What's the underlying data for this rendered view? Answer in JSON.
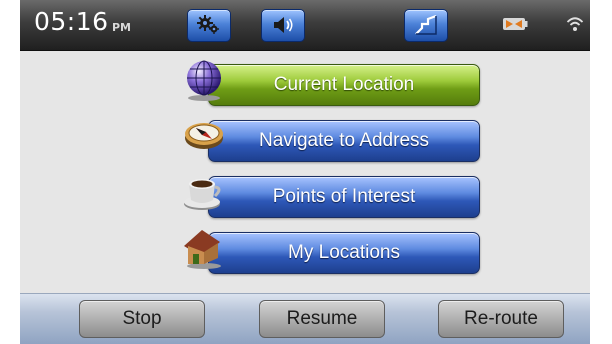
{
  "status_bar": {
    "time": "05:16",
    "ampm": "PM",
    "icons": [
      "gear-icon",
      "speaker-icon",
      "map-icon",
      "battery-icon",
      "wifi-icon"
    ]
  },
  "menu": {
    "items": [
      {
        "label": "Current Location",
        "icon": "globe-icon",
        "color": "#8cc63f"
      },
      {
        "label": "Navigate to Address",
        "icon": "compass-icon",
        "color": "#3f6fd0"
      },
      {
        "label": "Points of Interest",
        "icon": "coffee-cup-icon",
        "color": "#3f6fd0"
      },
      {
        "label": "My Locations",
        "icon": "house-icon",
        "color": "#3f6fd0"
      }
    ]
  },
  "toolbar": {
    "stop_label": "Stop",
    "resume_label": "Resume",
    "reroute_label": "Re-route"
  },
  "colors": {
    "status_bar": "#2c2c2c",
    "accent_blue": "#2e58b8",
    "accent_green": "#6f9d16",
    "toolbar_bg": "#b7c4d8"
  }
}
